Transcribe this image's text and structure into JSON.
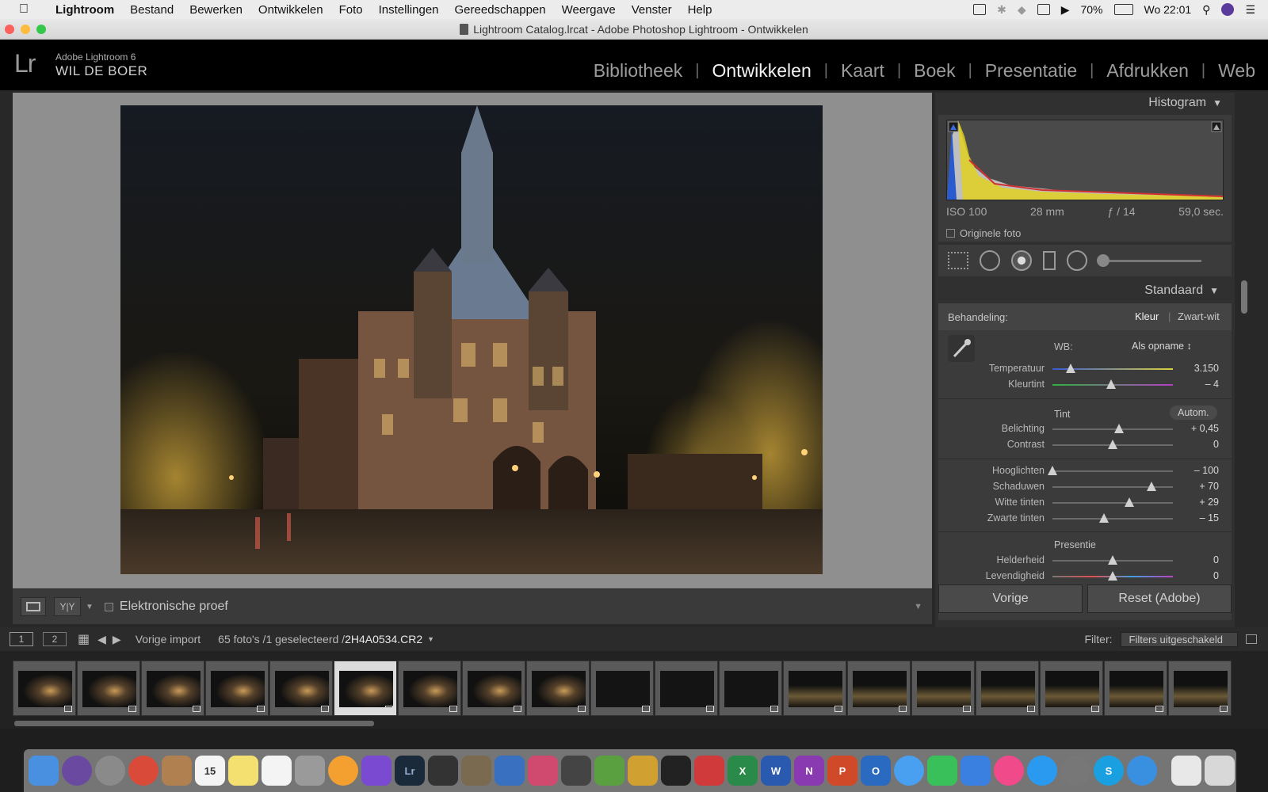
{
  "menubar": {
    "app": "Lightroom",
    "items": [
      "Bestand",
      "Bewerken",
      "Ontwikkelen",
      "Foto",
      "Instellingen",
      "Gereedschappen",
      "Weergave",
      "Venster",
      "Help"
    ],
    "battery": "70%",
    "clock": "Wo 22:01"
  },
  "window": {
    "title": "Lightroom Catalog.lrcat - Adobe Photoshop Lightroom - Ontwikkelen"
  },
  "identity": {
    "logo": "Lr",
    "version": "Adobe Lightroom 6",
    "user": "WIL DE BOER"
  },
  "modules": [
    {
      "label": "Bibliotheek",
      "active": false
    },
    {
      "label": "Ontwikkelen",
      "active": true
    },
    {
      "label": "Kaart",
      "active": false
    },
    {
      "label": "Boek",
      "active": false
    },
    {
      "label": "Presentatie",
      "active": false
    },
    {
      "label": "Afdrukken",
      "active": false
    },
    {
      "label": "Web",
      "active": false
    }
  ],
  "toolbar": {
    "proof_label": "Elektronische proef"
  },
  "histogram": {
    "title": "Histogram",
    "iso": "ISO 100",
    "focal": "28 mm",
    "aperture": "ƒ / 14",
    "shutter": "59,0 sec.",
    "original_label": "Originele foto"
  },
  "basic": {
    "preset_header": "Standaard",
    "treatment_label": "Behandeling:",
    "color_label": "Kleur",
    "bw_label": "Zwart-wit",
    "wb_label": "WB:",
    "wb_value": "Als opname",
    "tone_label": "Tint",
    "auto_label": "Autom.",
    "presence_label": "Presentie",
    "sliders": [
      {
        "name": "temperature",
        "label": "Temperatuur",
        "value": "3.150",
        "pos": 0.15
      },
      {
        "name": "tint",
        "label": "Kleurtint",
        "value": "– 4",
        "pos": 0.49
      },
      {
        "name": "exposure",
        "label": "Belichting",
        "value": "+ 0,45",
        "pos": 0.55
      },
      {
        "name": "contrast",
        "label": "Contrast",
        "value": "0",
        "pos": 0.5
      },
      {
        "name": "highlights",
        "label": "Hooglichten",
        "value": "– 100",
        "pos": 0.0
      },
      {
        "name": "shadows",
        "label": "Schaduwen",
        "value": "+ 70",
        "pos": 0.82
      },
      {
        "name": "whites",
        "label": "Witte tinten",
        "value": "+ 29",
        "pos": 0.64
      },
      {
        "name": "blacks",
        "label": "Zwarte tinten",
        "value": "– 15",
        "pos": 0.43
      },
      {
        "name": "clarity",
        "label": "Helderheid",
        "value": "0",
        "pos": 0.5
      },
      {
        "name": "vibrance",
        "label": "Levendigheid",
        "value": "0",
        "pos": 0.5
      }
    ]
  },
  "buttons": {
    "previous": "Vorige",
    "reset": "Reset (Adobe)"
  },
  "filmstrip": {
    "page1": "1",
    "page2": "2",
    "source": "Vorige import",
    "count": "65 foto's /1 geselecteerd /",
    "filename": "2H4A0534.CR2",
    "filter_label": "Filter:",
    "filter_value": "Filters uitgeschakeld"
  },
  "colors": {
    "accent": "#f2f2f2",
    "panel": "#3b3b3b"
  }
}
